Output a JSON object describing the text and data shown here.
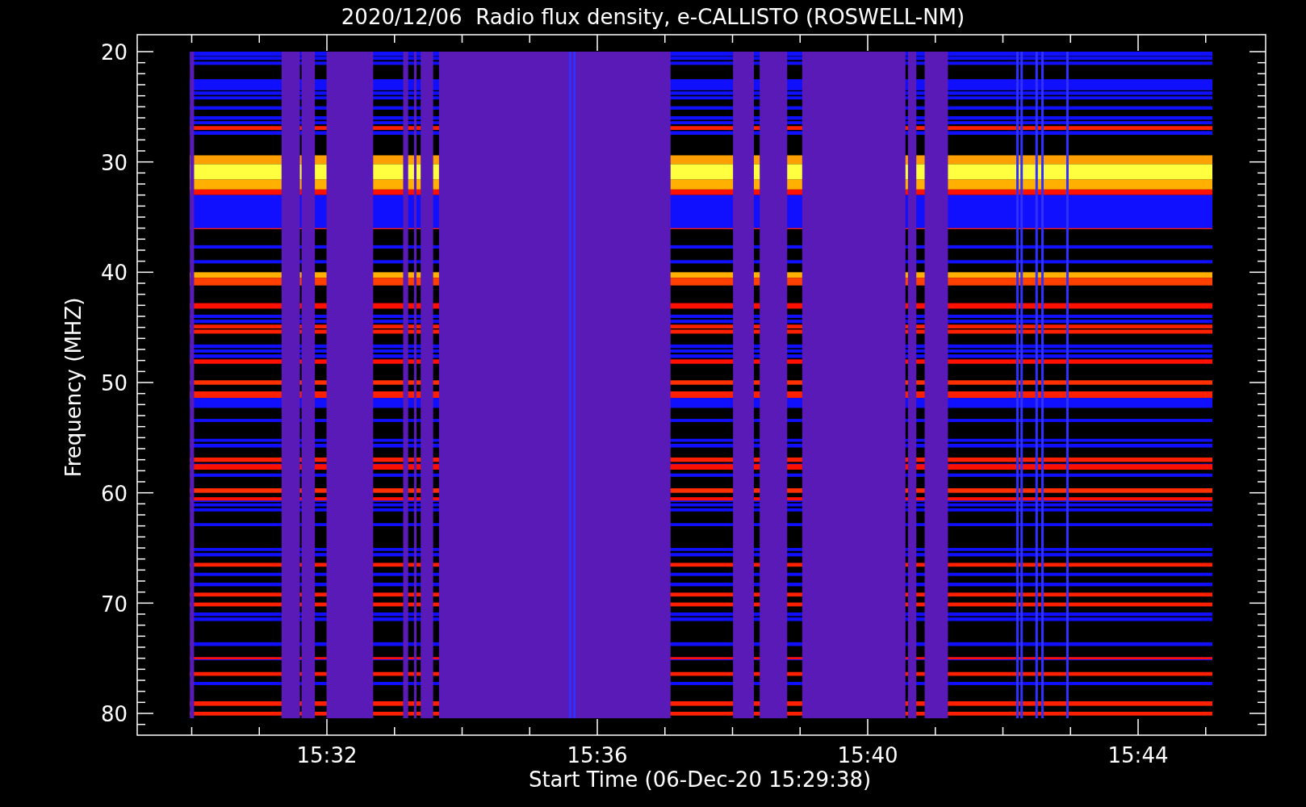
{
  "title": "2020/12/06  Radio flux density, e-CALLISTO (ROSWELL-NM)",
  "y_axis": {
    "label": "Frequency (MHZ)",
    "ticks": [
      "20",
      "30",
      "40",
      "50",
      "60",
      "70",
      "80"
    ]
  },
  "x_axis": {
    "label": "Start Time (06-Dec-20 15:29:38)",
    "ticks": [
      "15:32",
      "15:36",
      "15:40",
      "15:44"
    ]
  }
}
